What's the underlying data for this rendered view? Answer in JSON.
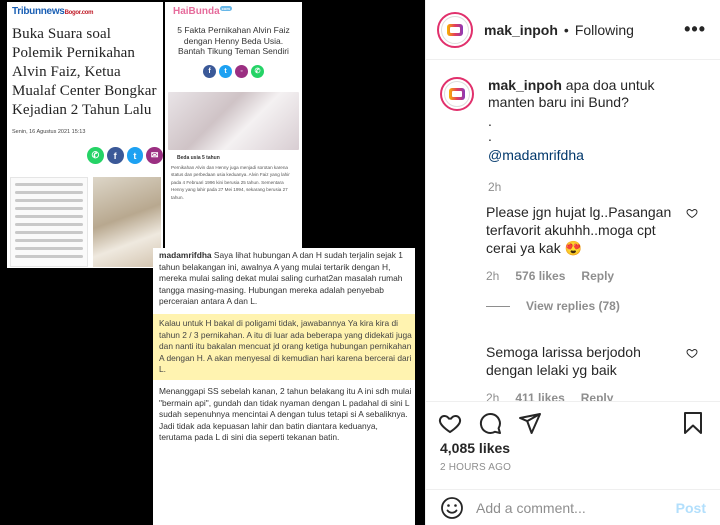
{
  "image": {
    "left_card": {
      "logo_main": "Tribunnews",
      "logo_sub": "Bogor.com",
      "headline": "Buka Suara soal Polemik Pernikahan Alvin Faiz, Ketua Mualaf Center Bongkar Kejadian 2 Tahun Lalu",
      "date": "Senin, 16 Agustus 2021 15:13"
    },
    "right_card": {
      "logo": "HaiBunda",
      "logo_badge": "com",
      "headline": "5 Fakta Pernikahan Alvin Faiz dengan Henny Beda Usia. Bantah Tikung Teman Sendiri",
      "caption": "Beda usia 5 tahun",
      "body": "Pernikahan Alvin dan Henny juga menjadi sorotan karena status dan perbedaan usia keduanya. Alvin Faiz yang lahir pada 4 Februari 1996 kini berusia 25 tahun. Sementara Henny yang lahir pada 27 Mei 1994, sekarang berusia 27 tahun."
    },
    "bottom_card": {
      "author": "madamrifdha",
      "para1": "Saya lihat hubungan A dan H sudah terjalin sejak 1 tahun belakangan ini, awalnya A yang mulai tertarik dengan H, mereka mulai saling dekat mulai saling curhat2an masalah rumah tangga masing-masing. Hubungan mereka adalah penyebab perceraian antara A dan L.",
      "highlight": "Kalau untuk H bakal di poligami tidak, jawabannya Ya kira kira di tahun 2 / 3 pernikahan. A itu di luar ada beberapa yang didekati juga dan nanti itu bakalan mencuat jd orang ketiga hubungan pernikahan A dengan H. A akan menyesal di kemudian hari karena bercerai dari L.",
      "para2": "Menanggapi SS sebelah kanan, 2 tahun belakang itu A ini sdh mulai \"bermain api\", gundah dan tidak nyaman dengan L padahal di sini L sudah sepenuhnya mencintai A dengan tulus tetapi si A sebaliknya. Jadi tidak ada kepuasan lahir dan batin diantara keduanya, terutama pada L di sini dia seperti tekanan batin."
    }
  },
  "header": {
    "username": "mak_inpoh",
    "separator": "•",
    "follow_status": "Following",
    "more": "•••",
    "avatar_label": "mak_inpoh"
  },
  "caption": {
    "username": "mak_inpoh",
    "text": "apa doa untuk manten baru ini Bund?",
    "dots": ".",
    "dots2": ".",
    "mention": "@madamrifdha",
    "time": "2h"
  },
  "comments": [
    {
      "username": "",
      "text": "Please jgn hujat lg..Pasangan terfavorit akuhhh..moga cpt cerai ya kak 😍",
      "time": "2h",
      "likes": "576 likes",
      "reply": "Reply",
      "view_replies": "View replies (78)"
    },
    {
      "username": "",
      "text": "Semoga larissa berjodoh dengan lelaki yg baik",
      "time": "2h",
      "likes": "411 likes",
      "reply": "Reply"
    }
  ],
  "stats": {
    "likes": "4,085 likes",
    "time_ago": "2 HOURS AGO"
  },
  "add_comment": {
    "placeholder": "Add a comment...",
    "post": "Post"
  },
  "colors": {
    "link": "#00376b",
    "muted": "#8e8e8e",
    "post_disabled": "#b2dffc",
    "highlight_bg": "#fff3b0"
  }
}
